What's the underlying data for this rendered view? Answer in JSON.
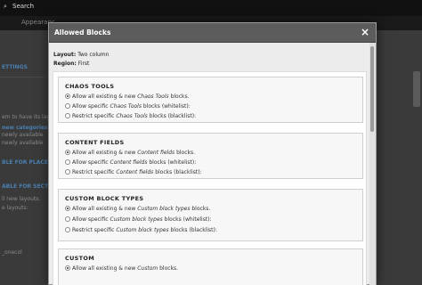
{
  "background": {
    "search_label": "Search",
    "tabs": [
      "Appearanc",
      "",
      ""
    ],
    "left_texts": [
      "ETTINGS",
      "em to have its lay",
      "new categories c",
      "newly available",
      "newly available",
      "BLE FOR PLACEME",
      "ABLE FOR SECTIO",
      "ll new layouts.",
      "e layouts:",
      "_onecol"
    ]
  },
  "modal": {
    "title": "Allowed Blocks",
    "close_symbol": "×",
    "layout_label": "Layout:",
    "layout_value": "Two column",
    "region_label": "Region:",
    "region_value": "First",
    "sections": [
      {
        "title": "CHAOS TOOLS",
        "options": [
          {
            "prefix": "Allow all existing & new ",
            "name": "Chaos Tools",
            "suffix": " blocks.",
            "checked": true
          },
          {
            "prefix": "Allow specific ",
            "name": "Chaos Tools",
            "suffix": " blocks (whitelist):",
            "checked": false
          },
          {
            "prefix": "Restrict specific ",
            "name": "Chaos Tools",
            "suffix": " blocks (blacklist):",
            "checked": false
          }
        ]
      },
      {
        "title": "CONTENT FIELDS",
        "options": [
          {
            "prefix": "Allow all existing & new ",
            "name": "Content fields",
            "suffix": " blocks.",
            "checked": true
          },
          {
            "prefix": "Allow specific ",
            "name": "Content fields",
            "suffix": " blocks (whitelist):",
            "checked": false
          },
          {
            "prefix": "Restrict specific ",
            "name": "Content fields",
            "suffix": " blocks (blacklist):",
            "checked": false
          }
        ]
      },
      {
        "title": "CUSTOM BLOCK TYPES",
        "options": [
          {
            "prefix": "Allow all existing & new ",
            "name": "Custom block types",
            "suffix": " blocks.",
            "checked": true
          },
          {
            "prefix": "Allow specific ",
            "name": "Custom block types",
            "suffix": " blocks (whitelist):",
            "checked": false
          },
          {
            "prefix": "Restrict specific ",
            "name": "Custom block types",
            "suffix": " blocks (blacklist):",
            "checked": false
          }
        ]
      },
      {
        "title": "CUSTOM",
        "options": [
          {
            "prefix": "Allow all existing & new ",
            "name": "Custom",
            "suffix": " blocks.",
            "checked": true
          }
        ]
      }
    ]
  }
}
